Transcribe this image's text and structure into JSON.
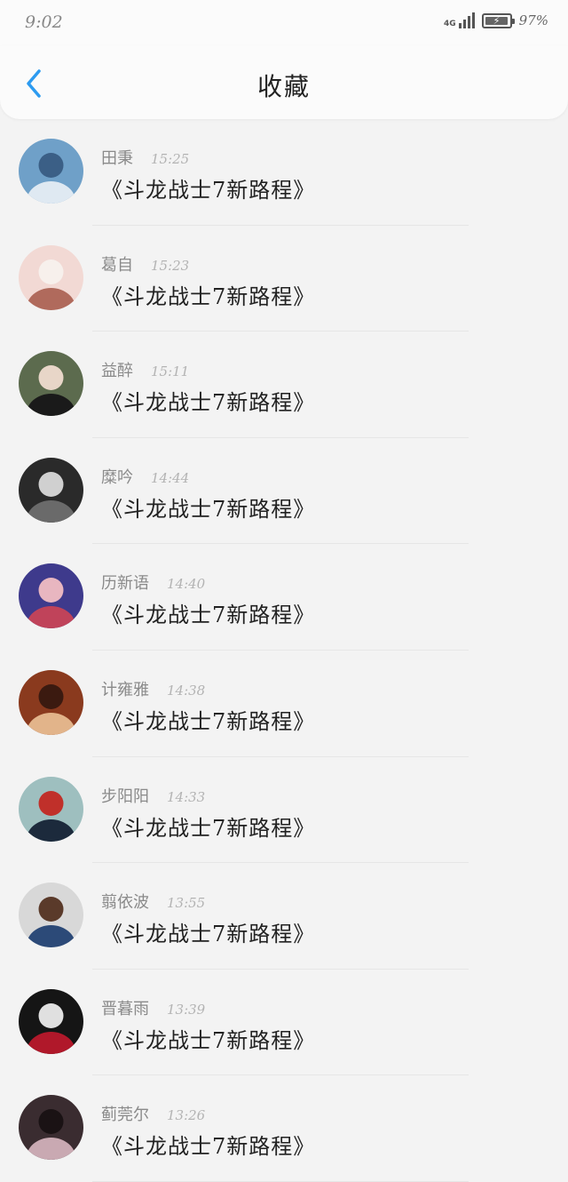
{
  "status_bar": {
    "time": "9:02",
    "network": "4G",
    "battery_percent": "97%",
    "battery_level": 0.97
  },
  "header": {
    "title": "收藏",
    "back_icon": "chevron-left-icon",
    "accent_color": "#2d9bf0"
  },
  "items": [
    {
      "name": "田秉",
      "time": "15:25",
      "message": "《斗龙战士7新路程》",
      "avatar": {
        "bg": "#6fa0c8",
        "fg": "#dfe9f2",
        "accent": "#3b5f86"
      }
    },
    {
      "name": "葛自",
      "time": "15:23",
      "message": "《斗龙战士7新路程》",
      "avatar": {
        "bg": "#f2d9d4",
        "fg": "#b06a5c",
        "accent": "#f7f0ec"
      }
    },
    {
      "name": "益醉",
      "time": "15:11",
      "message": "《斗龙战士7新路程》",
      "avatar": {
        "bg": "#5c6b4e",
        "fg": "#1a1a1a",
        "accent": "#e8d6c8"
      }
    },
    {
      "name": "糜吟",
      "time": "14:44",
      "message": "《斗龙战士7新路程》",
      "avatar": {
        "bg": "#2a2a2a",
        "fg": "#6a6a6a",
        "accent": "#d0d0d0"
      }
    },
    {
      "name": "历新语",
      "time": "14:40",
      "message": "《斗龙战士7新路程》",
      "avatar": {
        "bg": "#3e3a8c",
        "fg": "#c0435a",
        "accent": "#e8b6c0"
      }
    },
    {
      "name": "计雍雅",
      "time": "14:38",
      "message": "《斗龙战士7新路程》",
      "avatar": {
        "bg": "#8a3a1e",
        "fg": "#e2b48a",
        "accent": "#3b1a10"
      }
    },
    {
      "name": "步阳阳",
      "time": "14:33",
      "message": "《斗龙战士7新路程》",
      "avatar": {
        "bg": "#9ebfbf",
        "fg": "#1c2a3c",
        "accent": "#c0302a"
      }
    },
    {
      "name": "翦依波",
      "time": "13:55",
      "message": "《斗龙战士7新路程》",
      "avatar": {
        "bg": "#d8d8d8",
        "fg": "#2c4a78",
        "accent": "#5a3a2a"
      }
    },
    {
      "name": "晋暮雨",
      "time": "13:39",
      "message": "《斗龙战士7新路程》",
      "avatar": {
        "bg": "#151515",
        "fg": "#b0182a",
        "accent": "#e0e0e0"
      }
    },
    {
      "name": "蓟莞尔",
      "time": "13:26",
      "message": "《斗龙战士7新路程》",
      "avatar": {
        "bg": "#3a2c30",
        "fg": "#c9a9b2",
        "accent": "#1a1214"
      }
    }
  ]
}
